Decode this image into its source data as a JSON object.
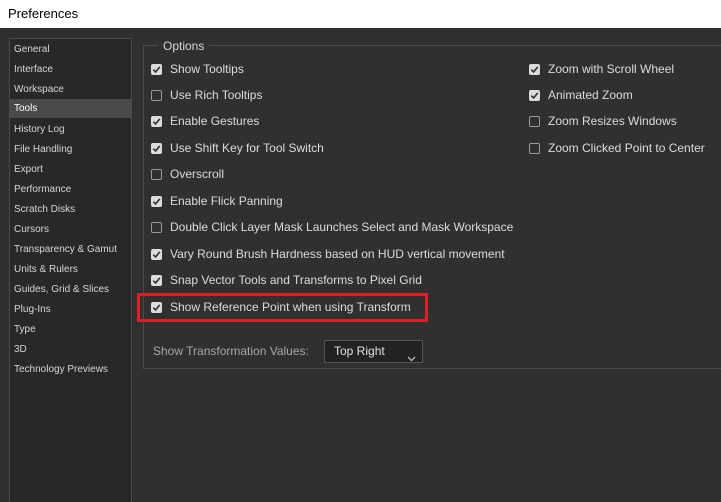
{
  "window": {
    "title": "Preferences"
  },
  "sidebar": {
    "items": [
      {
        "label": "General"
      },
      {
        "label": "Interface"
      },
      {
        "label": "Workspace"
      },
      {
        "label": "Tools",
        "selected": true
      },
      {
        "label": "History Log"
      },
      {
        "label": "File Handling"
      },
      {
        "label": "Export"
      },
      {
        "label": "Performance"
      },
      {
        "label": "Scratch Disks"
      },
      {
        "label": "Cursors"
      },
      {
        "label": "Transparency & Gamut"
      },
      {
        "label": "Units & Rulers"
      },
      {
        "label": "Guides, Grid & Slices"
      },
      {
        "label": "Plug-Ins"
      },
      {
        "label": "Type"
      },
      {
        "label": "3D"
      },
      {
        "label": "Technology Previews"
      }
    ]
  },
  "options": {
    "group_title": "Options",
    "left": [
      {
        "label": "Show Tooltips",
        "checked": true
      },
      {
        "label": "Use Rich Tooltips",
        "checked": false
      },
      {
        "label": "Enable Gestures",
        "checked": true
      },
      {
        "label": "Use Shift Key for Tool Switch",
        "checked": true
      },
      {
        "label": "Overscroll",
        "checked": false
      },
      {
        "label": "Enable Flick Panning",
        "checked": true
      },
      {
        "label": "Double Click Layer Mask Launches Select and Mask Workspace",
        "checked": false
      },
      {
        "label": "Vary Round Brush Hardness based on HUD vertical movement",
        "checked": true
      },
      {
        "label": "Snap Vector Tools and Transforms to Pixel Grid",
        "checked": true
      },
      {
        "label": "Show Reference Point when using Transform",
        "checked": true
      }
    ],
    "right": [
      {
        "label": "Zoom with Scroll Wheel",
        "checked": true
      },
      {
        "label": "Animated Zoom",
        "checked": true
      },
      {
        "label": "Zoom Resizes Windows",
        "checked": false
      },
      {
        "label": "Zoom Clicked Point to Center",
        "checked": false
      }
    ],
    "transformation_values": {
      "label": "Show Transformation Values:",
      "selected": "Top Right"
    }
  },
  "colors": {
    "highlight": "#e01e25",
    "background": "#303030"
  }
}
